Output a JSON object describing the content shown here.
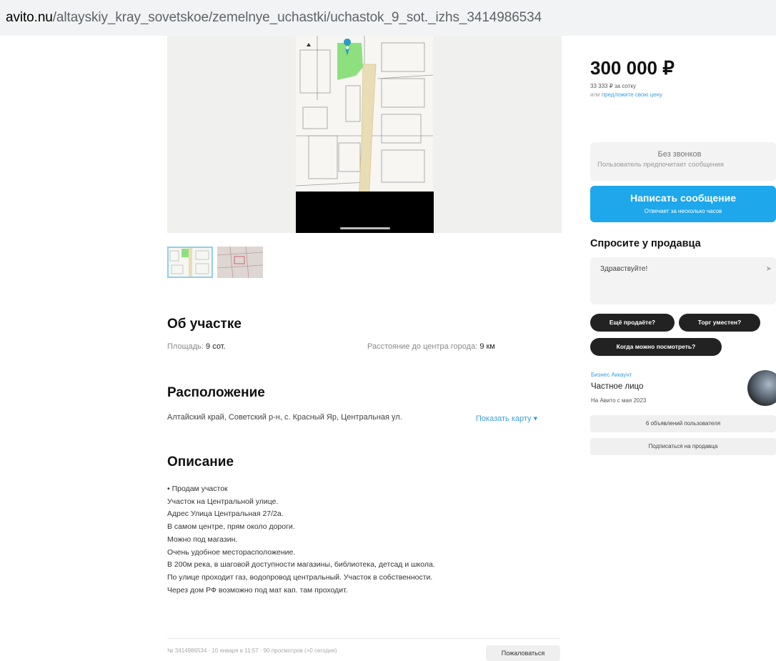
{
  "browser": {
    "url_domain": "avito.nu",
    "url_path": "/altayskiy_kray_sovetskoe/zemelnye_uchastki/uchastok_9_sot._izhs_3414986534"
  },
  "about": {
    "title": "Об участке",
    "area_label": "Площадь:",
    "area_value": "9 сот.",
    "distance_label": "Расстояние до центра города:",
    "distance_value": "9 км"
  },
  "location": {
    "title": "Расположение",
    "address": "Алтайский край, Советский р-н, с. Красный Яр, Центральная ул.",
    "show_map": "Показать карту ▾"
  },
  "description": {
    "title": "Описание",
    "lines": [
      "• Продам участок",
      "Участок на Центральной улице.",
      "Адрес Улица Центральная 27/2а.",
      "В самом центре, прям около дороги.",
      "Можно под магазин.",
      "Очень удобное месторасположение.",
      "В 200м река, в шаговой доступности магазины, библиотека, детсад и школа.",
      "По улице проходит газ, водопровод центральный. Участок в собственности.",
      "Через дом РФ возможно под мат кап. там проходит."
    ]
  },
  "footer": {
    "meta": "№ 3414986534 · 10 января в 11:57 · 90 просмотров (+0 сегодня)",
    "report": "Пожаловаться"
  },
  "sidebar": {
    "price": "300 000 ₽",
    "per_sotka": "33 333 ₽ за сотку",
    "offer_prefix": "или",
    "offer_link": "предложите свою цену",
    "no_calls_title": "Без звонков",
    "no_calls_sub": "Пользователь предпочитает сообщения",
    "message_btn": "Написать сообщение",
    "message_sub": "Отвечает за несколько часов",
    "ask_title": "Спросите у продавца",
    "ask_text": "Здравствуйте!",
    "chips": [
      "Ещё продаёте?",
      "Торг уместен?",
      "Когда можно посмотреть?"
    ],
    "business": "Бизнес Аккаунт",
    "person": "Частное лицо",
    "since": "На Авито с мая 2023",
    "ads_btn": "6 объявлений пользователя",
    "subscribe_btn": "Подписаться на продавца"
  },
  "colors": {
    "accent_blue": "#1ea7ea",
    "link_blue": "#3aa0dd",
    "map_green": "#8ee07f",
    "map_road": "#e8ddb5"
  }
}
